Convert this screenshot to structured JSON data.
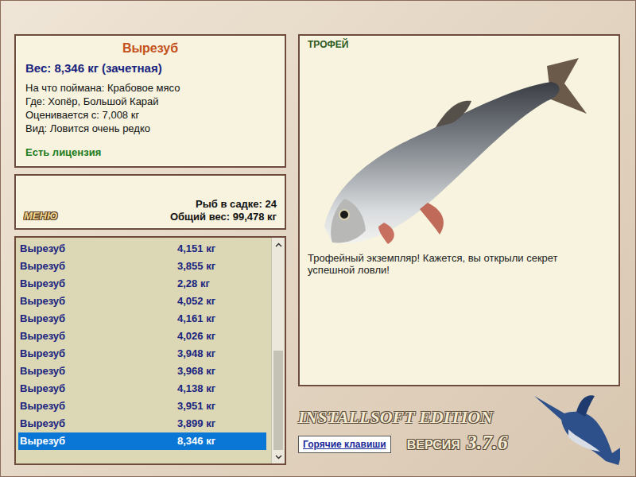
{
  "fish_card": {
    "name": "Вырезуб",
    "weight": "Вес: 8,346 кг (зачетная)",
    "details": [
      "На что поймана: Крабовое мясо",
      "Где: Хопёр, Большой Карай",
      "Оценивается с: 7,008 кг",
      "Вид: Ловится очень редко"
    ],
    "license": "Есть лицензия"
  },
  "keepnet": {
    "menu": "МЕНЮ",
    "count": "Рыб в садке: 24",
    "total": "Общий вес: 99,478 кг"
  },
  "catch_list": {
    "rows": [
      {
        "name": "Вырезуб",
        "weight": "4,151 кг",
        "selected": false
      },
      {
        "name": "Вырезуб",
        "weight": "3,855 кг",
        "selected": false
      },
      {
        "name": "Вырезуб",
        "weight": "2,28 кг",
        "selected": false
      },
      {
        "name": "Вырезуб",
        "weight": "4,052 кг",
        "selected": false
      },
      {
        "name": "Вырезуб",
        "weight": "4,161 кг",
        "selected": false
      },
      {
        "name": "Вырезуб",
        "weight": "4,026 кг",
        "selected": false
      },
      {
        "name": "Вырезуб",
        "weight": "3,948 кг",
        "selected": false
      },
      {
        "name": "Вырезуб",
        "weight": "3,968 кг",
        "selected": false
      },
      {
        "name": "Вырезуб",
        "weight": "4,138 кг",
        "selected": false
      },
      {
        "name": "Вырезуб",
        "weight": "3,951 кг",
        "selected": false
      },
      {
        "name": "Вырезуб",
        "weight": "3,899 кг",
        "selected": false
      },
      {
        "name": "Вырезуб",
        "weight": "8,346 кг",
        "selected": true
      }
    ],
    "scrollbar": {
      "level": 0.5
    }
  },
  "trophy": {
    "badge": "ТРОФЕЙ",
    "message": "Трофейный экземпляр! Кажется, вы открыли секрет успешной ловли!"
  },
  "footer": {
    "edition": "INSTALLSOFT EDITION",
    "version_label": "ВЕРСИЯ",
    "version": "3.7.6",
    "hotkeys": "Горячие клавиши"
  }
}
